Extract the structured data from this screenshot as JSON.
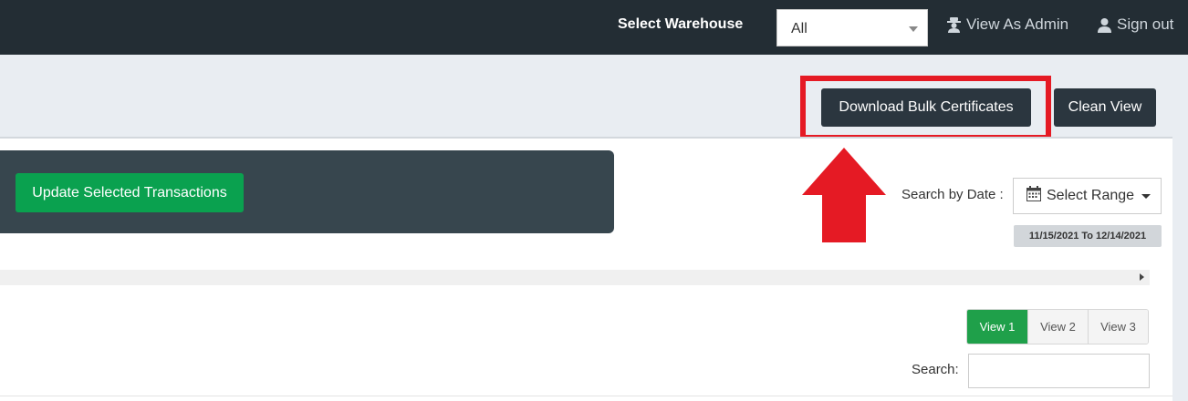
{
  "topbar": {
    "warehouse_label": "Select Warehouse",
    "warehouse_value": "All",
    "view_as_admin": "View As Admin",
    "sign_out": "Sign out"
  },
  "toolbar": {
    "download_bulk_label": "Download Bulk Certificates",
    "clean_view_label": "Clean View"
  },
  "actions": {
    "update_label": "Update Selected Transactions"
  },
  "date_filter": {
    "label": "Search by Date :",
    "range_button": "Select Range",
    "range_value": "11/15/2021 To 12/14/2021"
  },
  "views": {
    "items": [
      "View 1",
      "View 2",
      "View 3"
    ],
    "active": "View 1"
  },
  "search": {
    "label": "Search:",
    "value": ""
  },
  "colors": {
    "topbar": "#232d34",
    "accent_green": "#0aa14f",
    "highlight_red": "#e51a24"
  }
}
